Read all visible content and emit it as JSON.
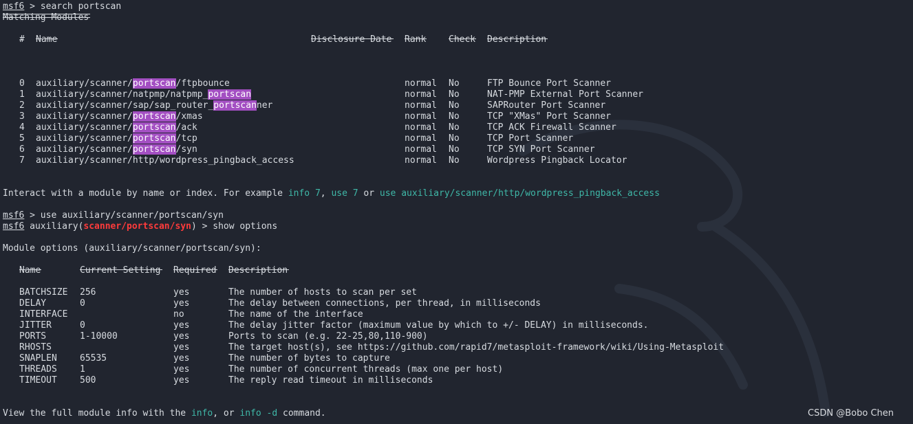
{
  "prompt": "msf6",
  "cmd1": {
    "sep": " > ",
    "text": "search portscan"
  },
  "matching_title": "Matching Modules",
  "modules_table": {
    "headers": {
      "num": "#",
      "name": "Name",
      "date": "Disclosure Date",
      "rank": "Rank",
      "check": "Check",
      "desc": "Description"
    },
    "dash": "-",
    "rows": [
      {
        "num": "0",
        "pre": "auxiliary/scanner/",
        "hl": "portscan",
        "post": "/ftpbounce",
        "rank": "normal",
        "check": "No",
        "desc": "FTP Bounce Port Scanner"
      },
      {
        "num": "1",
        "pre": "auxiliary/scanner/natpmp/natpmp_",
        "hl": "portscan",
        "post": "",
        "rank": "normal",
        "check": "No",
        "desc": "NAT-PMP External Port Scanner"
      },
      {
        "num": "2",
        "pre": "auxiliary/scanner/sap/sap_router_",
        "hl": "portscan",
        "post": "ner",
        "rank": "normal",
        "check": "No",
        "desc": "SAPRouter Port Scanner"
      },
      {
        "num": "3",
        "pre": "auxiliary/scanner/",
        "hl": "portscan",
        "post": "/xmas",
        "rank": "normal",
        "check": "No",
        "desc": "TCP \"XMas\" Port Scanner"
      },
      {
        "num": "4",
        "pre": "auxiliary/scanner/",
        "hl": "portscan",
        "post": "/ack",
        "rank": "normal",
        "check": "No",
        "desc": "TCP ACK Firewall Scanner"
      },
      {
        "num": "5",
        "pre": "auxiliary/scanner/",
        "hl": "portscan",
        "post": "/tcp",
        "rank": "normal",
        "check": "No",
        "desc": "TCP Port Scanner"
      },
      {
        "num": "6",
        "pre": "auxiliary/scanner/",
        "hl": "portscan",
        "post": "/syn",
        "rank": "normal",
        "check": "No",
        "desc": "TCP SYN Port Scanner"
      },
      {
        "num": "7",
        "pre": "auxiliary/scanner/http/wordpress_pingback_access",
        "hl": "",
        "post": "",
        "rank": "normal",
        "check": "No",
        "desc": "Wordpress Pingback Locator"
      }
    ]
  },
  "interact": {
    "prefix": "Interact with a module by name or index. For example ",
    "info7": "info 7",
    "comma": ", ",
    "use7": "use 7",
    "or": " or ",
    "usepath": "use auxiliary/scanner/http/wordpress_pingback_access"
  },
  "cmd2": {
    "sep": " > ",
    "text": "use auxiliary/scanner/portscan/syn"
  },
  "cmd3": {
    "module_pre": " auxiliary(",
    "module": "scanner/portscan/syn",
    "module_post": ")",
    "sep": " > ",
    "text": "show options"
  },
  "options_title": "Module options (auxiliary/scanner/portscan/syn):",
  "options_table": {
    "headers": {
      "name": "Name",
      "setting": "Current Setting",
      "required": "Required",
      "desc": "Description"
    },
    "rows": [
      {
        "name": "BATCHSIZE",
        "setting": "256",
        "required": "yes",
        "desc": "The number of hosts to scan per set"
      },
      {
        "name": "DELAY",
        "setting": "0",
        "required": "yes",
        "desc": "The delay between connections, per thread, in milliseconds"
      },
      {
        "name": "INTERFACE",
        "setting": "",
        "required": "no",
        "desc": "The name of the interface"
      },
      {
        "name": "JITTER",
        "setting": "0",
        "required": "yes",
        "desc": "The delay jitter factor (maximum value by which to +/- DELAY) in milliseconds."
      },
      {
        "name": "PORTS",
        "setting": "1-10000",
        "required": "yes",
        "desc": "Ports to scan (e.g. 22-25,80,110-900)"
      },
      {
        "name": "RHOSTS",
        "setting": "",
        "required": "yes",
        "desc": "The target host(s), see https://github.com/rapid7/metasploit-framework/wiki/Using-Metasploit"
      },
      {
        "name": "SNAPLEN",
        "setting": "65535",
        "required": "yes",
        "desc": "The number of bytes to capture"
      },
      {
        "name": "THREADS",
        "setting": "1",
        "required": "yes",
        "desc": "The number of concurrent threads (max one per host)"
      },
      {
        "name": "TIMEOUT",
        "setting": "500",
        "required": "yes",
        "desc": "The reply read timeout in milliseconds"
      }
    ]
  },
  "footer": {
    "prefix": "View the full module info with the ",
    "info": "info",
    "or": ", or ",
    "infod": "info -d",
    "suffix": " command."
  },
  "watermark": "CSDN @Bobo Chen",
  "colors": {
    "background": "#21252f",
    "text": "#d7dbe0",
    "prompt_module": "#ff3b3b",
    "command_hint": "#3fb8a8",
    "highlight": "#a34fc2"
  }
}
